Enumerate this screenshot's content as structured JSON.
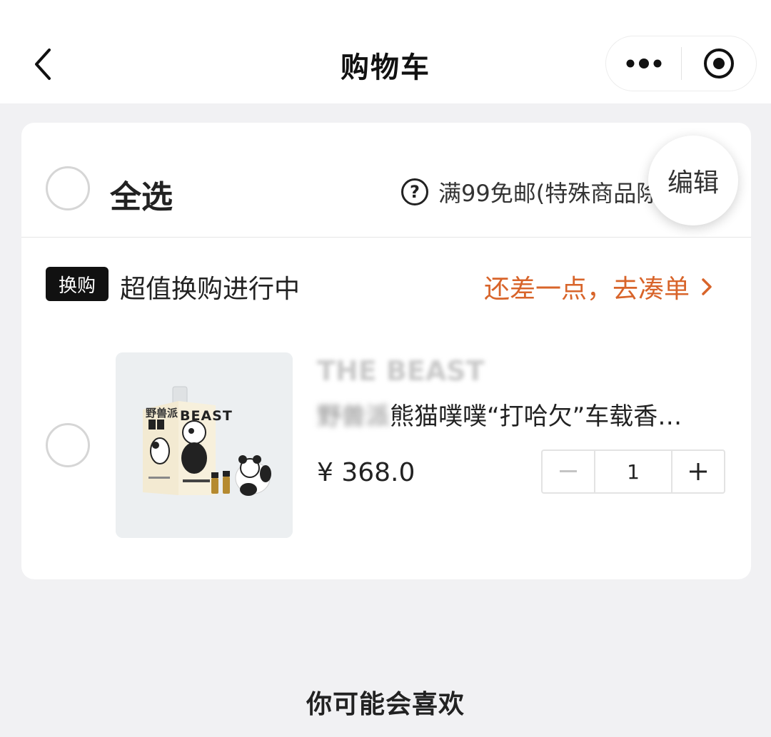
{
  "header": {
    "title": "购物车",
    "back_icon": "chevron-left-icon",
    "more_icon": "more-dots-icon",
    "close_icon": "target-circle-icon"
  },
  "cart": {
    "select_all_label": "全选",
    "shipping_note": "满99免邮(特殊商品除外)",
    "edit_label": "编辑",
    "promo": {
      "badge": "换购",
      "text": "超值换购进行中",
      "link": "还差一点，去凑单"
    },
    "items": [
      {
        "brand": "THE BEAST",
        "name_blurred": "野兽派",
        "name_visible": "熊猫噗噗“打哈欠”车载香…",
        "price": "¥ 368.0",
        "quantity": "1",
        "image_label_top": "野兽派",
        "image_label_brand": "BEAST"
      }
    ]
  },
  "recommend_title": "你可能会喜欢",
  "colors": {
    "accent": "#d8642a",
    "badge_bg": "#111111",
    "page_bg": "#f1f1f3"
  }
}
